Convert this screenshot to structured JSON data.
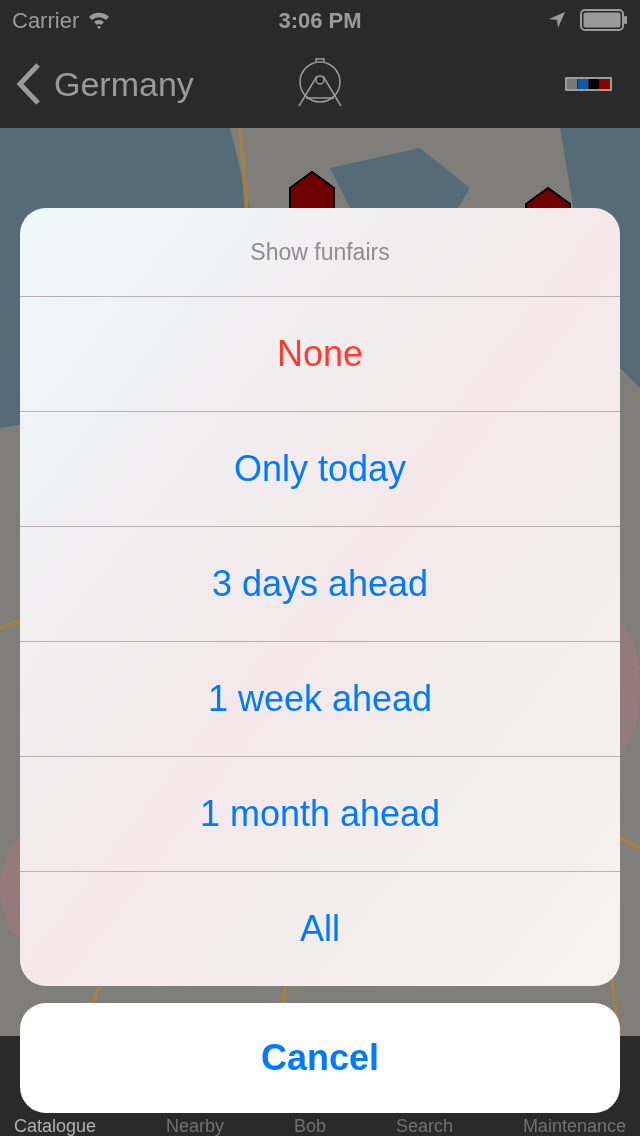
{
  "status_bar": {
    "carrier": "Carrier",
    "time": "3:06 PM"
  },
  "nav_bar": {
    "back_label": "Germany"
  },
  "action_sheet": {
    "title": "Show funfairs",
    "options": [
      {
        "label": "None",
        "kind": "destructive"
      },
      {
        "label": "Only today",
        "kind": "default"
      },
      {
        "label": "3 days ahead",
        "kind": "default"
      },
      {
        "label": "1 week ahead",
        "kind": "default"
      },
      {
        "label": "1 month ahead",
        "kind": "default"
      },
      {
        "label": "All",
        "kind": "default"
      }
    ],
    "cancel": "Cancel"
  },
  "tab_bar": [
    {
      "label": "Catalogue",
      "selected": true
    },
    {
      "label": "Nearby",
      "selected": false
    },
    {
      "label": "Bob",
      "selected": false
    },
    {
      "label": "Search",
      "selected": false
    },
    {
      "label": "Maintenance",
      "selected": false
    }
  ]
}
